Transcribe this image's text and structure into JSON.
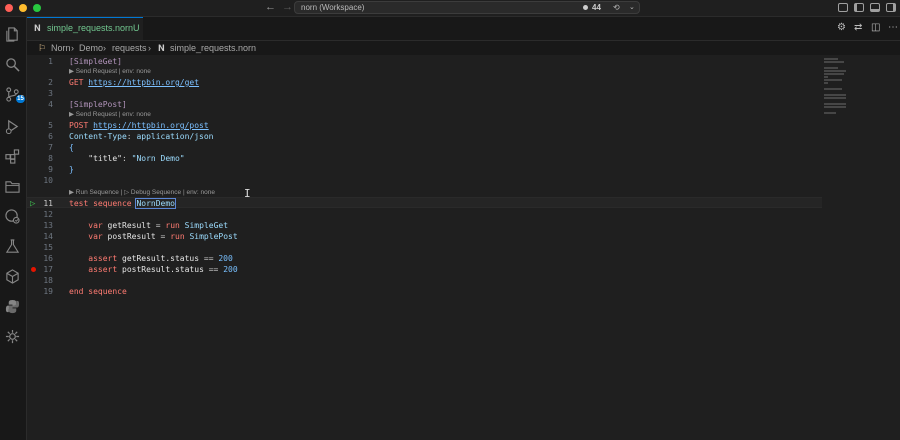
{
  "window": {
    "title": "norn (Workspace)",
    "problems_count": "44",
    "colors": {
      "close": "#ff5f57",
      "minimize": "#febc2e",
      "zoom": "#28c840",
      "accent": "#0078d4"
    }
  },
  "activity_bar": {
    "items": [
      {
        "name": "explorer-icon"
      },
      {
        "name": "search-icon"
      },
      {
        "name": "source-control-icon",
        "badge": "15"
      },
      {
        "name": "run-debug-icon"
      },
      {
        "name": "extensions-icon"
      },
      {
        "name": "folder-icon"
      },
      {
        "name": "remote-icon"
      },
      {
        "name": "testing-icon"
      },
      {
        "name": "package-icon"
      },
      {
        "name": "python-icon"
      },
      {
        "name": "settings-bug-icon"
      }
    ]
  },
  "tab": {
    "label": "simple_requests.norn",
    "status": "U"
  },
  "breadcrumbs": [
    "Norn",
    "Demo",
    "requests",
    "simple_requests.norn"
  ],
  "code_lens": {
    "send_request": "▶ Send Request | env: none",
    "run_sequence": "▶ Run Sequence | ▷ Debug Sequence | env: none"
  },
  "lines": [
    {
      "n": "1",
      "text": "[SimpleGet]"
    },
    {
      "n": "2",
      "method": "GET",
      "url": "https://httpbin.org/get"
    },
    {
      "n": "3",
      "text": ""
    },
    {
      "n": "4",
      "text": "[SimplePost]"
    },
    {
      "n": "5",
      "method": "POST",
      "url": "https://httpbin.org/post"
    },
    {
      "n": "6",
      "key": "Content-Type",
      "value": "application/json"
    },
    {
      "n": "7",
      "text": "{"
    },
    {
      "n": "8",
      "json_key": "\"title\"",
      "json_value": "\"Norn Demo\""
    },
    {
      "n": "9",
      "text": "}"
    },
    {
      "n": "10",
      "text": ""
    },
    {
      "n": "11",
      "kw": "test sequence",
      "name": "NornDemo"
    },
    {
      "n": "12",
      "text": ""
    },
    {
      "n": "13",
      "var": "var",
      "ident": "getResult",
      "op": "=",
      "run": "run",
      "target": "SimpleGet"
    },
    {
      "n": "14",
      "var": "var",
      "ident": "postResult",
      "op": "=",
      "run": "run",
      "target": "SimplePost"
    },
    {
      "n": "15",
      "text": ""
    },
    {
      "n": "16",
      "assert": "assert",
      "expr": "getResult.status",
      "op": "==",
      "value": "200"
    },
    {
      "n": "17",
      "assert": "assert",
      "expr": "postResult.status",
      "op": "==",
      "value": "200"
    },
    {
      "n": "18",
      "text": ""
    },
    {
      "n": "19",
      "end": "end sequence"
    }
  ]
}
